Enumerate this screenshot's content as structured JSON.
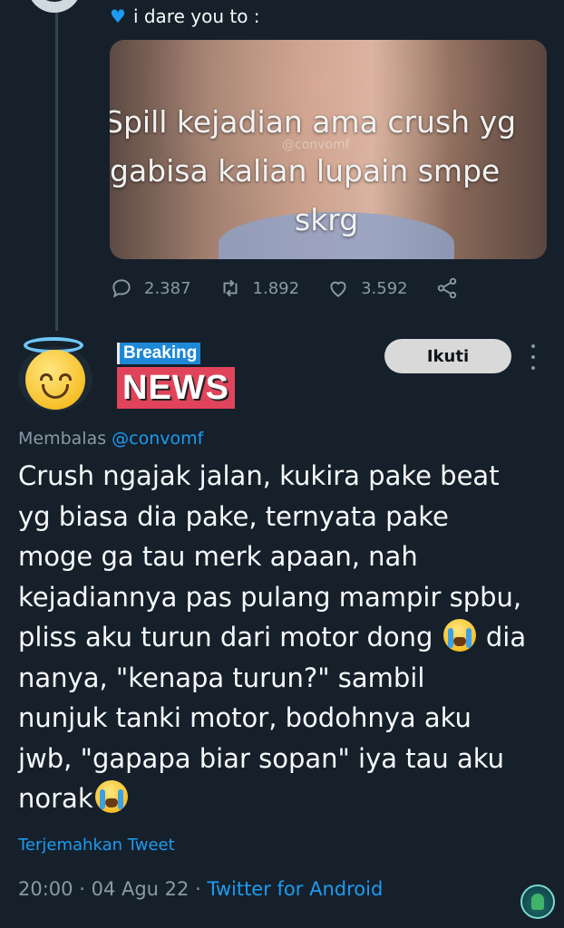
{
  "parent_tweet": {
    "text": "i dare you to :",
    "heart_icon": "blue-heart-emoji",
    "media": {
      "overlay_lines": [
        "Spill kejadian ama crush yg",
        "gabisa kalian lupain smpe",
        "skrg"
      ],
      "watermark": "@convomf"
    },
    "actions": {
      "replies": "2.387",
      "retweets": "1.892",
      "likes": "3.592"
    }
  },
  "reply_tweet": {
    "display_name_top": "Breaking",
    "display_name_bottom": "NEWS",
    "follow_label": "Ikuti",
    "replying_prefix": "Membalas",
    "replying_handle": "@convomf",
    "body_lines": [
      "Crush ngajak jalan, kukira pake beat",
      "yg biasa dia pake, ternyata pake",
      "moge ga tau merk apaan, nah",
      "kejadiannya pas pulang mampir spbu,",
      "pliss aku turun dari motor dong",
      "dia",
      "nanya, \"kenapa turun?\" sambil",
      "nunjuk tanki motor, bodohnya aku",
      "jwb, \"gapapa biar sopan\" iya tau aku",
      "norak"
    ],
    "translate_label": "Terjemahkan Tweet",
    "time": "20:00",
    "date": "04 Agu 22",
    "source": "Twitter for Android"
  },
  "colors": {
    "background": "#15202b",
    "accent": "#1d9bf0",
    "muted": "#8b98a5"
  }
}
